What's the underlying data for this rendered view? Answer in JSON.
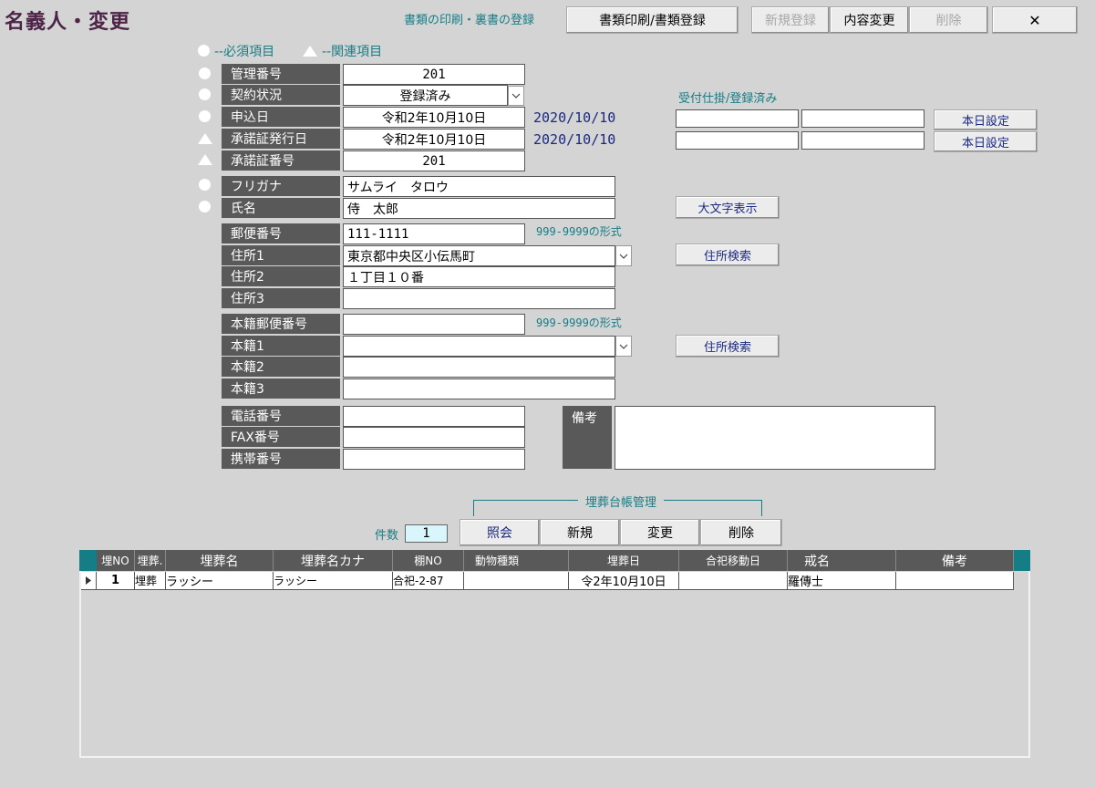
{
  "window": {
    "title": "名義人・変更"
  },
  "header": {
    "print_caption": "書類の印刷・裏書の登録",
    "print_button": "書類印刷/書類登録",
    "new_button": "新規登録",
    "edit_button": "内容変更",
    "delete_button": "削除",
    "close_button": "✕"
  },
  "legend": {
    "required": "--必須項目",
    "related": "--関連項目"
  },
  "form": {
    "management_no": {
      "label": "管理番号",
      "value": "201"
    },
    "contract_status": {
      "label": "契約状況",
      "value": "登録済み"
    },
    "application_date": {
      "label": "申込日",
      "value": "令和2年10月10日",
      "western": "2020/10/10"
    },
    "approval_issue_date": {
      "label": "承諾証発行日",
      "value": "令和2年10月10日",
      "western": "2020/10/10"
    },
    "approval_no": {
      "label": "承諾証番号",
      "value": "201"
    },
    "furigana": {
      "label": "フリガナ",
      "value": "サムライ　タロウ"
    },
    "name": {
      "label": "氏名",
      "value": "侍　太郎"
    },
    "postal_code": {
      "label": "郵便番号",
      "value": "111-1111",
      "hint": "999-9999の形式"
    },
    "address1": {
      "label": "住所1",
      "value": "東京都中央区小伝馬町"
    },
    "address2": {
      "label": "住所2",
      "value": "１丁目１０番"
    },
    "address3": {
      "label": "住所3",
      "value": ""
    },
    "domicile_postal": {
      "label": "本籍郵便番号",
      "value": "",
      "hint": "999-9999の形式"
    },
    "domicile1": {
      "label": "本籍1",
      "value": ""
    },
    "domicile2": {
      "label": "本籍2",
      "value": ""
    },
    "domicile3": {
      "label": "本籍3",
      "value": ""
    },
    "phone": {
      "label": "電話番号",
      "value": ""
    },
    "fax": {
      "label": "FAX番号",
      "value": ""
    },
    "mobile": {
      "label": "携帯番号",
      "value": ""
    },
    "remarks": {
      "label": "備考",
      "value": ""
    }
  },
  "right_panel": {
    "status_caption": "受付仕掛/登録済み",
    "today_button_1": "本日設定",
    "today_button_2": "本日設定",
    "large_text_button": "大文字表示",
    "address_search_1": "住所検索",
    "address_search_2": "住所検索"
  },
  "burial": {
    "group_caption": "埋葬台帳管理",
    "count_label": "件数",
    "count_value": "1",
    "buttons": {
      "inquiry": "照会",
      "new": "新規",
      "edit": "変更",
      "delete": "削除"
    },
    "columns": [
      "埋NO",
      "埋葬.",
      "埋葬名",
      "埋葬名カナ",
      "棚NO",
      "動物種類",
      "埋葬日",
      "合祀移動日",
      "戒名",
      "備考"
    ],
    "rows": [
      [
        "1",
        "埋葬",
        "ラッシー",
        "ラッシー",
        "合祀-2-87",
        "",
        "令2年10月10日",
        "",
        "羅傳士",
        ""
      ]
    ]
  },
  "colors": {
    "label_bg": "#595959",
    "accent_teal": "#157d86",
    "title": "#4d2448"
  }
}
